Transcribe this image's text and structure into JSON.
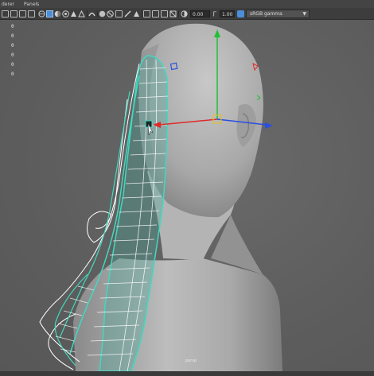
{
  "menu": {
    "items": [
      "derer",
      "Panels"
    ]
  },
  "toolbar": {
    "field_1": "0.00",
    "field_2": "1.00",
    "color_space": "sRGB gamma"
  },
  "viewport": {
    "hud_values": [
      "0",
      "0",
      "0",
      "0",
      "0",
      "0"
    ],
    "camera_label": "persp"
  },
  "colors": {
    "viewport_bg": "#5f5f5f",
    "selection_wire": "#40d9c0",
    "wire": "#ffffff",
    "axis_x": "#e02a2a",
    "axis_y": "#22c033",
    "axis_z": "#2a4fe0",
    "pivot": "#e0c030"
  },
  "icons": [
    "grid-icon",
    "film-icon",
    "camera-icon",
    "wireframe-icon",
    "shaded-icon",
    "textured-icon",
    "light-icon",
    "shadow-icon",
    "isolate-icon",
    "xray-icon",
    "resolution-gate-icon",
    "field-chart-icon",
    "safe-area-icon",
    "exposure-icon",
    "gamma-icon"
  ]
}
